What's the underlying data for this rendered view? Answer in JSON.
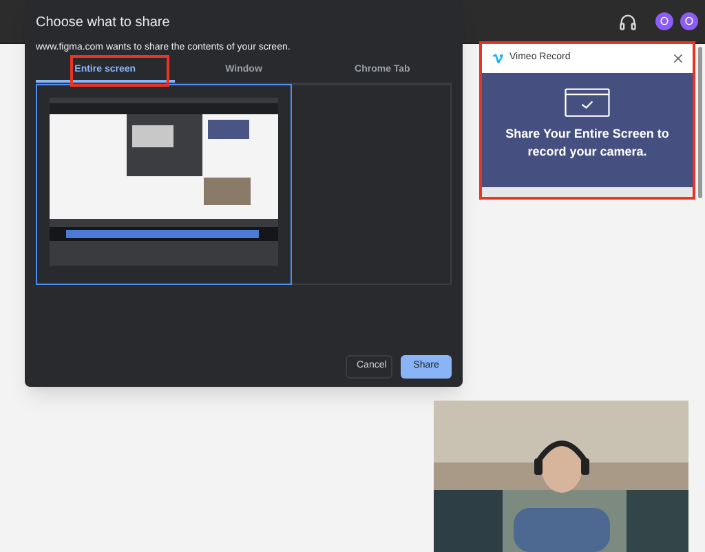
{
  "top_bar": {
    "avatars": [
      {
        "initial": "O"
      },
      {
        "initial": "O"
      }
    ]
  },
  "dialog": {
    "title": "Choose what to share",
    "subtitle": "www.figma.com wants to share the contents of your screen.",
    "tabs": [
      {
        "label": "Entire screen",
        "selected": true
      },
      {
        "label": "Window",
        "selected": false
      },
      {
        "label": "Chrome Tab",
        "selected": false
      }
    ],
    "sources": [
      {
        "kind": "picture",
        "selected": true
      }
    ],
    "buttons": [
      {
        "label": "Cancel",
        "kind": "secondary"
      },
      {
        "label": "Share",
        "kind": "primary"
      }
    ]
  },
  "vimeo_panel": {
    "title": "Vimeo Record",
    "message": "Share Your Entire Screen to record your camera."
  },
  "camera_preview": {
    "kind": "picture"
  }
}
